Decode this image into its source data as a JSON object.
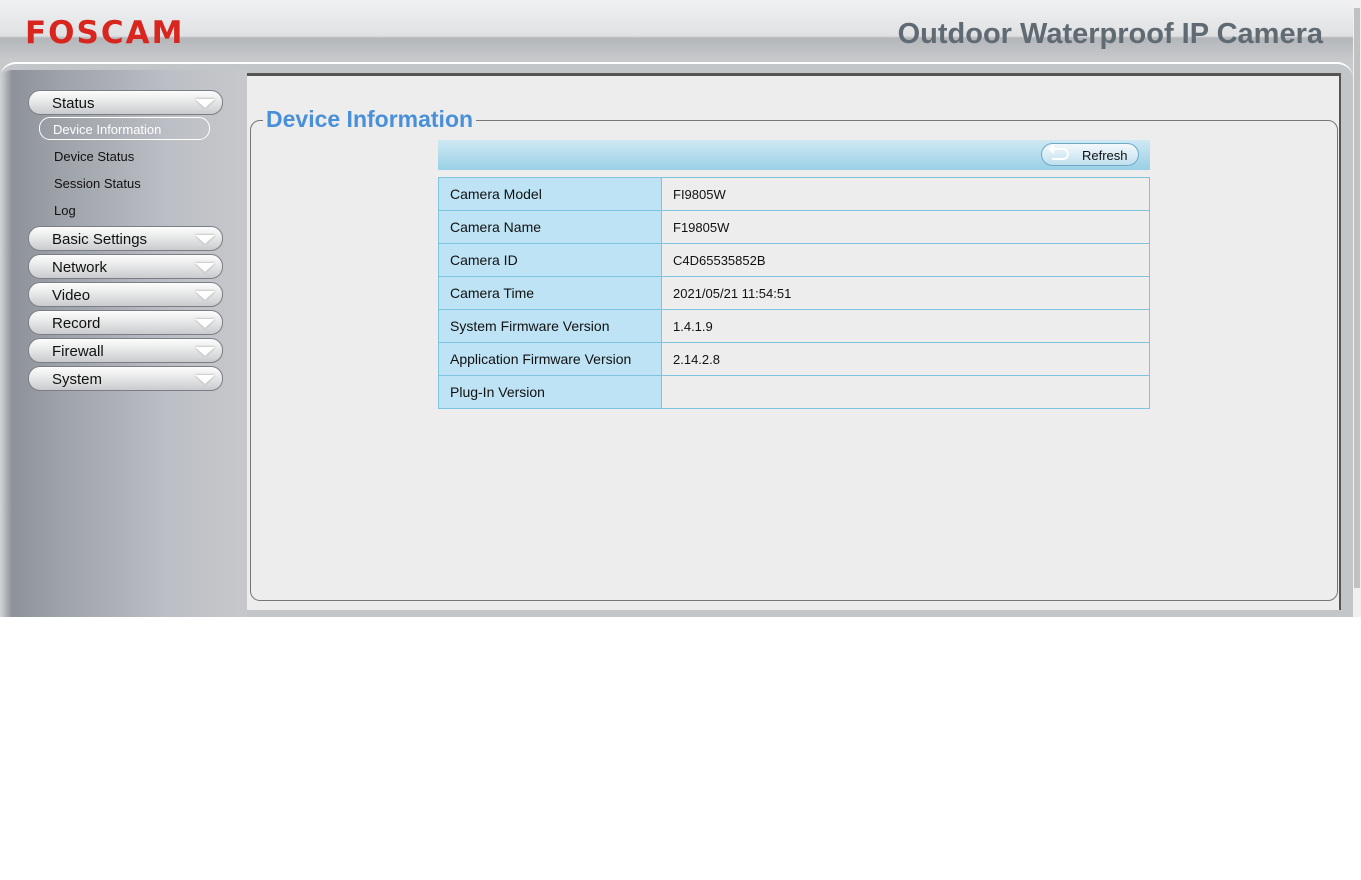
{
  "header": {
    "logo": "FOSCAM",
    "product": "Outdoor Waterproof IP Camera"
  },
  "sidebar": {
    "status": "Status",
    "status_items": [
      "Device Information",
      "Device Status",
      "Session Status",
      "Log"
    ],
    "menus": [
      "Basic Settings",
      "Network",
      "Video",
      "Record",
      "Firewall",
      "System"
    ]
  },
  "main": {
    "title": "Device Information",
    "refresh_label": "Refresh",
    "rows": [
      {
        "label": "Camera Model",
        "value": "FI9805W"
      },
      {
        "label": "Camera Name",
        "value": "F19805W"
      },
      {
        "label": "Camera ID",
        "value": "C4D65535852B"
      },
      {
        "label": "Camera Time",
        "value": "2021/05/21 11:54:51"
      },
      {
        "label": "System Firmware Version",
        "value": "1.4.1.9"
      },
      {
        "label": "Application Firmware Version",
        "value": "2.14.2.8"
      },
      {
        "label": "Plug-In Version",
        "value": ""
      }
    ]
  }
}
